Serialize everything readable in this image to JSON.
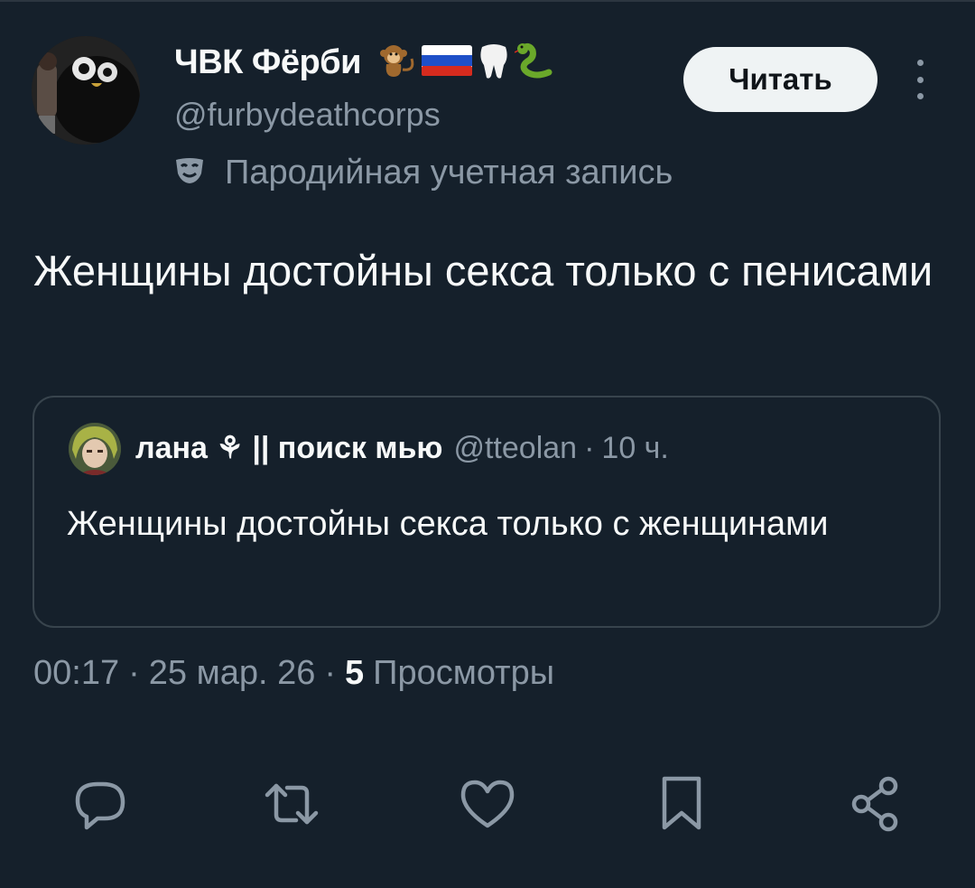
{
  "author": {
    "display_name": "ЧВК Фёрби",
    "flair_emojis": [
      "monkey-emoji",
      "russia-flag-emoji",
      "tooth-emoji",
      "snake-emoji"
    ],
    "handle": "@furbydeathcorps",
    "parody_label": "Пародийная учетная запись"
  },
  "header": {
    "follow_label": "Читать"
  },
  "tweet": {
    "text": "Женщины достойны секса только с пенисами"
  },
  "quote": {
    "name": "лана ⚘ || поиск мью",
    "handle": "@tteolan",
    "separator": "·",
    "time": "10 ч.",
    "text": "Женщины достойны секса только с женщинами"
  },
  "meta": {
    "time": "00:17",
    "separator": "·",
    "date": "25 мар. 26",
    "views_count": "5",
    "views_label": "Просмотры"
  },
  "actions": [
    "reply-icon",
    "retweet-icon",
    "like-icon",
    "bookmark-icon",
    "share-icon"
  ],
  "colors": {
    "background": "#15202b",
    "primary_text": "#f7f9f9",
    "secondary_text": "#8b98a5",
    "border": "#38444d",
    "follow_button_bg": "#eff3f4"
  }
}
